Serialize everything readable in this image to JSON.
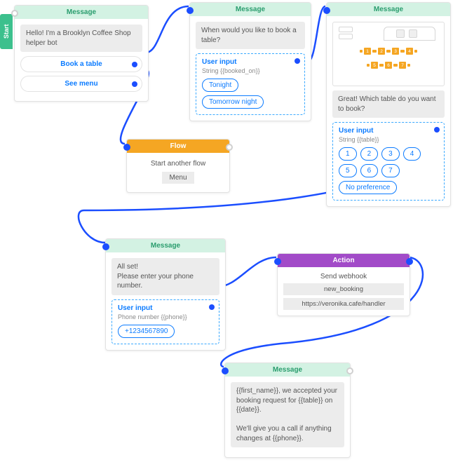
{
  "start_label": "Start",
  "node1": {
    "header": "Message",
    "text": "Hello! I'm a Brooklyn Coffee Shop helper bot",
    "replies": [
      "Book a table",
      "See menu"
    ]
  },
  "node2": {
    "header": "Message",
    "text": "When would you like to book a table?",
    "ui_title": "User input",
    "ui_sub": "String {{booked_on}}",
    "chips": [
      "Tonight",
      "Tomorrow night"
    ]
  },
  "node3": {
    "header": "Message",
    "text": "Great! Which table do you want to book?",
    "ui_title": "User input",
    "ui_sub": "String  {{table}}",
    "chips": [
      "1",
      "2",
      "3",
      "4",
      "5",
      "6",
      "7",
      "No preference"
    ],
    "floor_tables": [
      "1",
      "2",
      "3",
      "4",
      "5",
      "6",
      "7"
    ]
  },
  "node4": {
    "header": "Flow",
    "text": "Start another flow",
    "tag": "Menu"
  },
  "node5": {
    "header": "Message",
    "text": "All set!\nPlease enter your phone number.",
    "ui_title": "User input",
    "ui_sub": "Phone number {{phone}}",
    "chips": [
      "+1234567890"
    ]
  },
  "node6": {
    "header": "Action",
    "text": "Send webhook",
    "rows": [
      "new_booking",
      "https://veronika.cafe/handler"
    ]
  },
  "node7": {
    "header": "Message",
    "text": "{{first_name}}, we accepted your booking request for {{table}} on {{date}}.\n\nWe'll give you a call if anything changes at {{phone}}."
  }
}
